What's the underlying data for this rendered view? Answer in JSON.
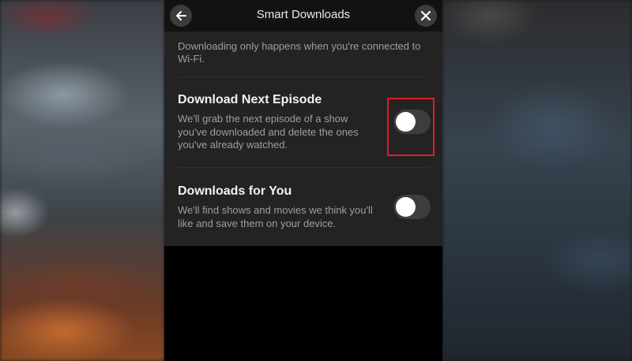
{
  "header": {
    "title": "Smart Downloads",
    "back_icon": "arrow-left-icon",
    "close_icon": "close-icon"
  },
  "intro_text": "Downloading only happens when you're connected to Wi-Fi.",
  "options": [
    {
      "title": "Download Next Episode",
      "description": "We'll grab the next episode of a show you've downloaded and delete the ones you've already watched.",
      "enabled": false
    },
    {
      "title": "Downloads for You",
      "description": "We'll find shows and movies we think you'll like and save them on your device.",
      "enabled": false
    }
  ],
  "colors": {
    "highlight": "#e01e25",
    "toggle_off": "#3d3d3d",
    "toggle_on": "#e50914",
    "panel": "#232323"
  }
}
